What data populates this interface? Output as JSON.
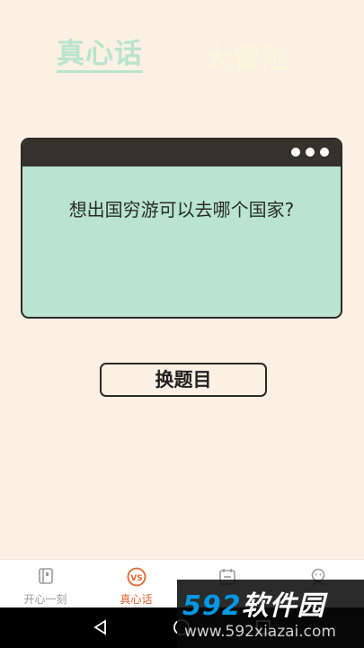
{
  "top_tabs": [
    {
      "label": "真心话",
      "active": true
    },
    {
      "label": "大冒险",
      "active": false
    }
  ],
  "card": {
    "question": "想出国穷游可以去哪个国家?"
  },
  "buttons": {
    "swap_question": "换题目"
  },
  "bottom_nav": [
    {
      "label": "开心一刻",
      "icon": "book-icon",
      "active": false
    },
    {
      "label": "真心话",
      "icon": "vs-icon",
      "active": true
    },
    {
      "label": "",
      "icon": "calendar-icon",
      "active": false
    },
    {
      "label": "",
      "icon": "profile-icon",
      "active": false
    }
  ],
  "watermark": {
    "brand_number": "592",
    "brand_text": "软件园",
    "url": "www.592xiazai.com"
  },
  "colors": {
    "background": "#fbf0e3",
    "card": "#b9e5d0",
    "card_titlebar": "#35322c",
    "active_tab": "#b8e4cd",
    "nav_active": "#e8622e",
    "watermark_accent": "#0099e6"
  }
}
